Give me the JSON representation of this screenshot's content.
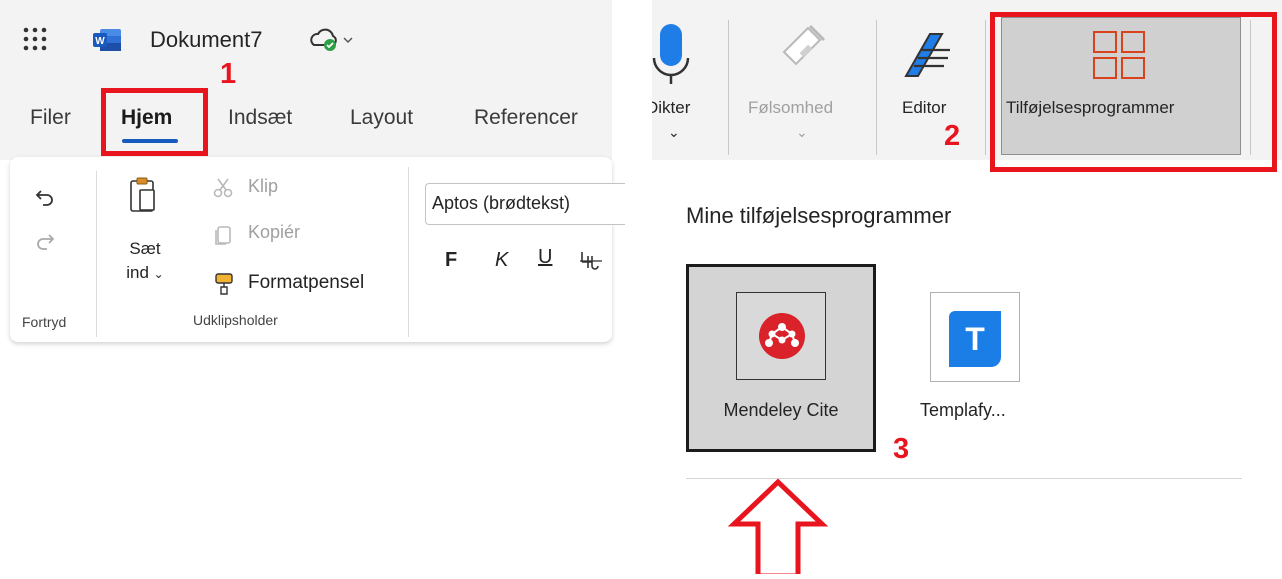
{
  "titlebar": {
    "doc_name": "Dokument7",
    "word_badge": "W"
  },
  "tabs": [
    "Filer",
    "Hjem",
    "Indsæt",
    "Layout",
    "Referencer"
  ],
  "ribbon_left": {
    "clipboard": {
      "paste_line1": "Sæt",
      "paste_line2": "ind",
      "cut": "Klip",
      "copy": "Kopiér",
      "format_painter": "Formatpensel",
      "group_label": "Udklipsholder"
    },
    "undo_group_label": "Fortryd",
    "font": {
      "font_name": "Aptos (brødtekst)",
      "bold": "F",
      "italic": "K",
      "underline": "U"
    }
  },
  "ribbon_right": {
    "dictate": "Dikter",
    "sensitivity": "Følsomhed",
    "editor": "Editor",
    "addins": "Tilføjelsesprogrammer"
  },
  "addins_panel": {
    "heading": "Mine tilføjelsesprogrammer",
    "items": [
      {
        "label": "Mendeley Cite",
        "icon": "mendeley-icon",
        "color": "#d9222a"
      },
      {
        "label": "Templafy...",
        "icon": "templafy-icon",
        "glyph": "T",
        "color": "#1a7ee6"
      }
    ]
  },
  "annotations": [
    "1",
    "2",
    "3"
  ],
  "colors": {
    "annotation_red": "#e8141e",
    "word_blue": "#185abd",
    "accent_underline": "#185abd"
  }
}
